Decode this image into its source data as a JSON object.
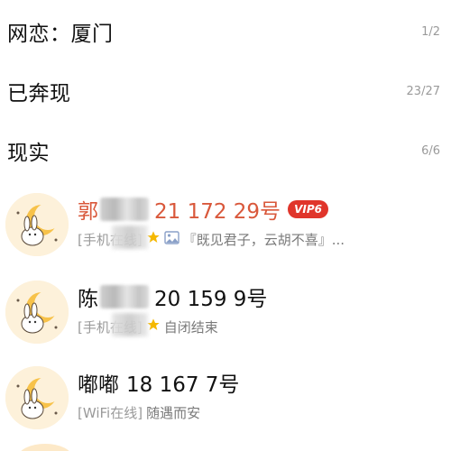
{
  "groups": [
    {
      "name": "网恋：厦门",
      "count": "1/2"
    },
    {
      "name": "已奔现",
      "count": "23/27"
    },
    {
      "name": "现实",
      "count": "6/6"
    }
  ],
  "contacts": [
    {
      "name_prefix": "郭",
      "name_suffix": "21 172 29号",
      "vip_label": "VIP6",
      "status": "[手机在线]",
      "signature": "『既见君子，云胡不喜』..."
    },
    {
      "name_prefix": "陈",
      "name_suffix": "20 159 9号",
      "status": "[手机在线]",
      "signature": "自闭结束"
    },
    {
      "name_prefix": "嘟嘟",
      "name_suffix": "18 167 7号",
      "status": "[WiFi在线]",
      "signature": "随遇而安"
    }
  ],
  "colors": {
    "vip_name": "#d9583b",
    "vip_badge": "#e0352b",
    "star": "#f5b800",
    "avatar_bg": "#fdf1da"
  },
  "icons": [
    "star-icon",
    "picture-icon",
    "bunny-moon-avatar"
  ]
}
